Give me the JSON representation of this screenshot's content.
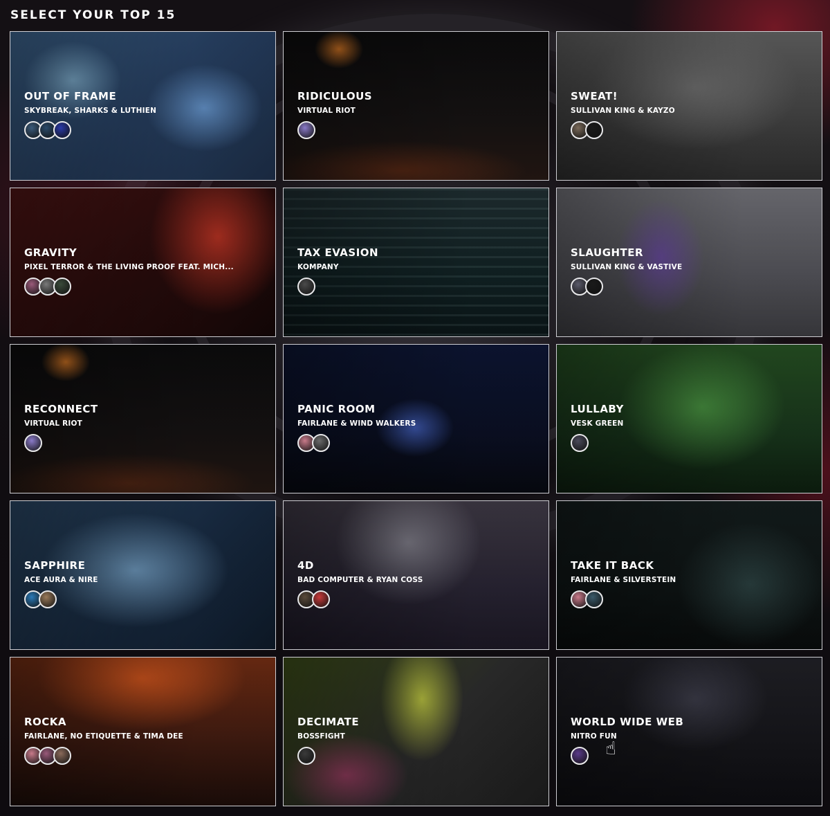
{
  "heading": "SELECT YOUR TOP 15",
  "cards": [
    {
      "title": "OUT OF FRAME",
      "artists": "SKYBREAK, SHARKS & LUTHIEN",
      "avatars": [
        "#3a5a7a",
        "#2a4a6a",
        "#2a3aa8"
      ]
    },
    {
      "title": "RIDICULOUS",
      "artists": "VIRTUAL RIOT",
      "avatars": [
        "#8a7ac8"
      ]
    },
    {
      "title": "SWEAT!",
      "artists": "SULLIVAN KING & KAYZO",
      "avatars": [
        "#7a6a5a",
        "#1a1a1a"
      ]
    },
    {
      "title": "GRAVITY",
      "artists": "PIXEL TERROR & THE LIVING PROOF FEAT. MICH...",
      "avatars": [
        "#9a5a7a",
        "#7a7a7a",
        "#3a4a3a"
      ]
    },
    {
      "title": "TAX EVASION",
      "artists": "KOMPANY",
      "avatars": [
        "#4a4a4a"
      ]
    },
    {
      "title": "SLAUGHTER",
      "artists": "SULLIVAN KING & VASTIVE",
      "avatars": [
        "#5a5a6a",
        "#1a1a1a"
      ]
    },
    {
      "title": "RECONNECT",
      "artists": "VIRTUAL RIOT",
      "avatars": [
        "#8a7ac8"
      ]
    },
    {
      "title": "PANIC ROOM",
      "artists": "FAIRLANE & WIND WALKERS",
      "avatars": [
        "#c87a8a",
        "#6a6a6a"
      ]
    },
    {
      "title": "LULLABY",
      "artists": "VESK GREEN",
      "avatars": [
        "#4a4a5a"
      ]
    },
    {
      "title": "SAPPHIRE",
      "artists": "ACE AURA & NIRE",
      "avatars": [
        "#2a7ab8",
        "#9a7a5a"
      ]
    },
    {
      "title": "4D",
      "artists": "BAD COMPUTER & RYAN COSS",
      "avatars": [
        "#5a4a3a",
        "#c83a3a"
      ]
    },
    {
      "title": "TAKE IT BACK",
      "artists": "FAIRLANE & SILVERSTEIN",
      "avatars": [
        "#c87a8a",
        "#3a5a6a"
      ]
    },
    {
      "title": "ROCKA",
      "artists": "FAIRLANE, NO ETIQUETTE & TIMA DEE",
      "avatars": [
        "#c87a8a",
        "#9a5a7a",
        "#8a6a5a"
      ]
    },
    {
      "title": "DECIMATE",
      "artists": "BOSSFIGHT",
      "avatars": [
        "#3a3a3a"
      ]
    },
    {
      "title": "WORLD WIDE WEB",
      "artists": "NITRO FUN",
      "avatars": [
        "#5a3a8a"
      ]
    }
  ],
  "icons": {
    "cursor": "hand-pointer-icon"
  }
}
